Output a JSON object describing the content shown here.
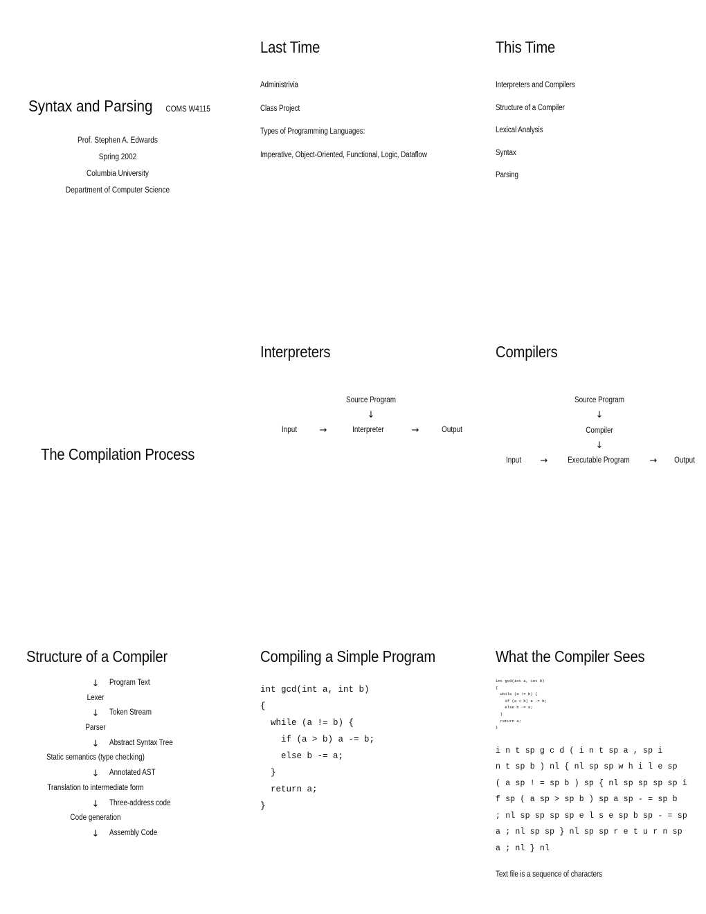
{
  "page": {
    "kind": "lecture-slide-handout",
    "text_color": "#0d0d0d",
    "background_color": "#ffffff"
  },
  "title_slide": {
    "title": "Syntax and Parsing",
    "course": "COMS W4115",
    "instructor": "Prof. Stephen A. Edwards",
    "term": "Spring 2002",
    "university": "Columbia University",
    "department": "Department of Computer Science"
  },
  "last_time": {
    "heading": "Last Time",
    "items": [
      "Administrivia",
      "Class Project",
      "Types of Programming Languages:",
      "Imperative, Object-Oriented, Functional, Logic, Dataflow"
    ]
  },
  "this_time": {
    "heading": "This Time",
    "items": [
      "Interpreters and Compilers",
      "Structure of a Compiler",
      "Lexical Analysis",
      "Syntax",
      "Parsing"
    ]
  },
  "compilation_process": {
    "heading": "The Compilation Process"
  },
  "interpreters": {
    "heading": "Interpreters",
    "source_label": "Source Program",
    "down_arrow": "↓",
    "right_arrow": "→",
    "input_label": "Input",
    "engine_label": "Interpreter",
    "output_label": "Output"
  },
  "compilers": {
    "heading": "Compilers",
    "source_label": "Source Program",
    "down_arrow": "↓",
    "right_arrow": "→",
    "compiler_label": "Compiler",
    "input_label": "Input",
    "engine_label": "Executable Program",
    "output_label": "Output"
  },
  "structure": {
    "heading": "Structure of a Compiler",
    "down_arrow": "↓",
    "rows": [
      {
        "type": "arrow",
        "stage": "↓",
        "artifact": "Program Text"
      },
      {
        "type": "stage",
        "stage": "Lexer",
        "artifact": ""
      },
      {
        "type": "arrow",
        "stage": "↓",
        "artifact": "Token Stream"
      },
      {
        "type": "stage",
        "stage": "Parser",
        "artifact": ""
      },
      {
        "type": "arrow",
        "stage": "↓",
        "artifact": "Abstract Syntax Tree"
      },
      {
        "type": "stage",
        "stage": "Static semantics (type checking)",
        "artifact": ""
      },
      {
        "type": "arrow",
        "stage": "↓",
        "artifact": "Annotated AST"
      },
      {
        "type": "stage",
        "stage": "Translation to intermediate form",
        "artifact": ""
      },
      {
        "type": "arrow",
        "stage": "↓",
        "artifact": "Three-address code"
      },
      {
        "type": "stage",
        "stage": "Code generation",
        "artifact": ""
      },
      {
        "type": "arrow",
        "stage": "↓",
        "artifact": "Assembly Code"
      }
    ]
  },
  "simple_program": {
    "heading": "Compiling a Simple Program",
    "code": "int gcd(int a, int b)\n{\n  while (a != b) {\n    if (a > b) a -= b;\n    else b -= a;\n  }\n  return a;\n}"
  },
  "compiler_sees": {
    "heading": "What the Compiler Sees",
    "code": "int gcd(int a, int b)\n{\n  while (a != b) {\n    if (a > b) a -= b;\n    else b -= a;\n  }\n  return a;\n}",
    "character_stream": "i n t sp g c d ( i n t sp a , sp i\nn t sp b ) nl { nl sp sp w h i l e sp\n( a sp ! = sp b ) sp { nl sp sp sp sp i\nf sp ( a sp > sp b ) sp a sp - = sp b\n; nl sp sp sp sp e l s e sp b sp - = sp\na ; nl sp sp } nl sp sp r e t u r n sp\na ; nl } nl",
    "caption": "Text file is a sequence of characters"
  }
}
